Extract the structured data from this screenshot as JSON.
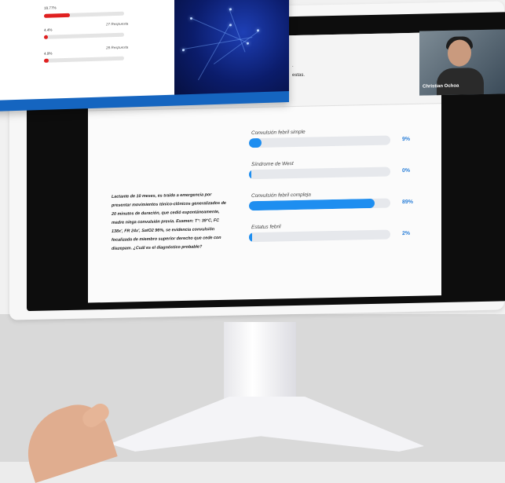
{
  "popup": {
    "poll_rows": [
      {
        "pct": "18.77%",
        "responses": "",
        "fill": 0.32
      },
      {
        "pct": "4.4%",
        "responses": "27 Respuesta",
        "fill": 0.05
      },
      {
        "pct": "4.9%",
        "responses": "28 Respuesta",
        "fill": 0.06
      }
    ]
  },
  "slide": {
    "header_lines": [
      ".",
      "estas."
    ],
    "question": "Lactante de 10 meses, es traído a emergencia por presentar movimientos tónico-clónicos generalizados de 20 minutos de duración, que cedió espontáneamente, madre niega convulsión previa. Examen: T°: 39°C, FC 138x', FR 24x', SatO2 96%, se evidencia convulsión focalizada de miembro superior derecho que cede con diazepam. ¿Cuál es el diagnóstico probable?",
    "options": [
      {
        "label": "Convulsión febril simple",
        "pct": "9%",
        "fill": 0.09
      },
      {
        "label": "Síndrome de West",
        "pct": "0%",
        "fill": 0.0
      },
      {
        "label": "Convulsión febril compleja",
        "pct": "89%",
        "fill": 0.89
      },
      {
        "label": "Estatus febril",
        "pct": "2%",
        "fill": 0.02
      }
    ]
  },
  "speaker": {
    "name": "Christian Ochoa"
  },
  "colors": {
    "accent": "#1e8ef0",
    "popup": "#1565c0",
    "poll_bar": "#e02020"
  }
}
